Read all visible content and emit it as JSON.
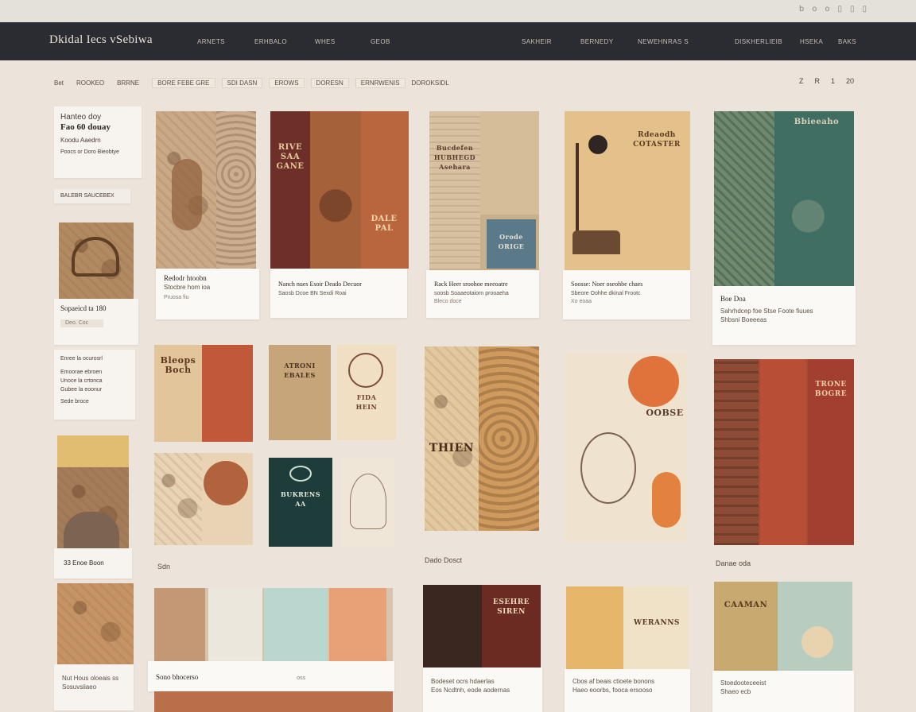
{
  "top_icons": [
    "b",
    "o",
    "o",
    "▯",
    "▯",
    "▯"
  ],
  "brand": "Dkidal Iecs vSebiwa",
  "nav": [
    "ARNETS",
    "ERHBALO",
    "WHES",
    "GEOB",
    "SAKHEIR",
    "BERNEDY",
    "NEWEHNRAS S",
    "DISKHERLIEIB",
    "HSEKA",
    "BAKS"
  ],
  "filters": {
    "plain": [
      "Bet",
      "ROOKEO",
      "BRRNE"
    ],
    "boxed": [
      "BORE FEBE GRE",
      "SDI DASN",
      "EROWS",
      "DORESN",
      "ERNRWENIS"
    ],
    "tail": "DOROKSIDL"
  },
  "pager": [
    "Z",
    "R",
    "1",
    "20"
  ],
  "sidebar": {
    "intro_small": "Hanteo doy",
    "intro_title": "Fao 60 douay",
    "intro_sub": "Koodu Aaedrn",
    "intro_note": "Poocs or Doro Bieobtye",
    "tag": "BALEBR SAUCEBEX",
    "card1_cap": "Sopaeicd ta 180",
    "card1_small": "Deo. Coc",
    "card2_lines": [
      "Enree la ocurosrl",
      "Emoorae ebroen",
      "Unoce la crtonca",
      "Gubee la eoonur",
      "Sede broce"
    ],
    "card3_cap": "33 Enoe Boon",
    "card4_lines": [
      "Nut Hous oloeais ss",
      "Sosuvsiiaeo"
    ]
  },
  "cards": [
    {
      "l1": "Redodr htoobn",
      "l2": "Stocbre hom ioa",
      "l3": "Pruosa fiu"
    },
    {
      "l1": "Nanch nues  Esoir Deado Decuor",
      "l2": "Saosb Dcoe BN  Sexdi Roai",
      "l3": ""
    },
    {
      "l1": "Rack Heer  sroohoe meeoatre",
      "l2": "soosb Soaaeotaiorn prooaeha",
      "l3": "Bleco doce"
    },
    {
      "l1": "Soosse: Noer oseohbe chaes",
      "l2": "Sbeore Oohhe dkinal Frootc",
      "l3": "Xo eoaa"
    },
    {
      "l1": "Boe  Doa",
      "l2": "Sahrhdcep foe Stse Foote fiuues",
      "l3": "Shbsni  Boeeeas"
    }
  ],
  "section_labels": [
    "Sdn",
    "Dado Dosct",
    "Danae oda"
  ],
  "bottom": {
    "wide_cap": "Sono bhocerso",
    "wide_cap2": "oss",
    "c3_l1": "Bodeset ocrs  hdaerlas",
    "c3_l2": "Eos Ncdtnh, eode aodernas",
    "c4_l1": "Cbos  af beais  ctioete bonons",
    "c4_l2": "Haeo eoorbs, fooca ersooso",
    "c5_l1": "Stoedooteceeist",
    "c5_l2": "Shaeo ecb"
  },
  "art_labels": {
    "c2": "RIVE\nSAA\nGANE",
    "c2b": "DALE\nPAL",
    "c3": "Bucdefen\nHUBHEGD\nAsehara",
    "c3b": "Orode\nORIGE",
    "c4": "Rdeaodh\nCOTASTER",
    "c5": "Bbieeaho",
    "m1": "Bleops\nBoch",
    "m2": "ATRONI\nEBALES",
    "m3": "FIDA\nHEIN",
    "m4": "BUKRENS\nAA",
    "big1": "THIEN",
    "big2": "OOBSE",
    "big3": "TRONE\nBOGRE",
    "b1": "ESEHRE\nSIREN",
    "b2": "CAAMAN",
    "b3": "WERANNS"
  },
  "colors": {
    "bg": "#ece4da",
    "nav": "#2b2c31",
    "sepia": "#b89879",
    "rust": "#a9533a",
    "teal": "#3f6c63",
    "ochre": "#d9b36a",
    "deep_red": "#8a3526"
  }
}
